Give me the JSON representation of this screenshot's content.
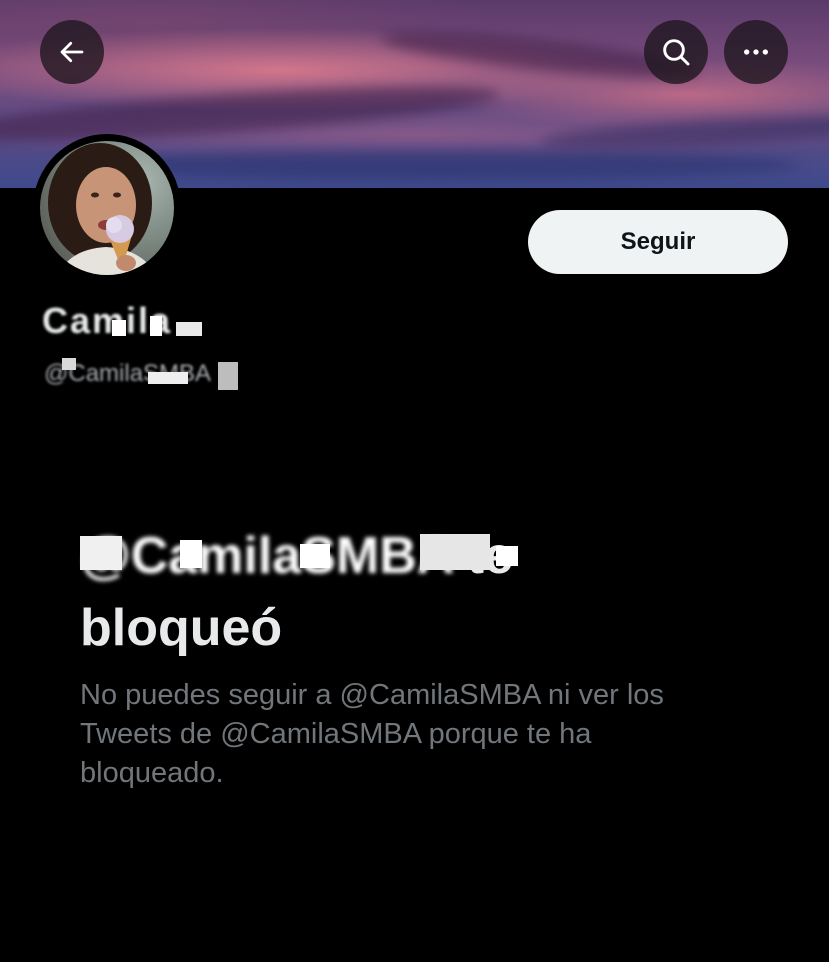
{
  "header": {
    "back_icon": "arrow-left-icon",
    "search_icon": "search-icon",
    "more_icon": "more-horizontal-icon"
  },
  "profile": {
    "display_name": "Camila",
    "handle": "@CamilaSMBA",
    "follow_label": "Seguir"
  },
  "blocked": {
    "title_handle": "@CamilaSMBA",
    "title_rest": " te bloqueó",
    "description": "No puedes seguir a @CamilaSMBA ni ver los Tweets de @CamilaSMBA porque te ha bloqueado."
  },
  "colors": {
    "background": "#000000",
    "follow_button_bg": "#eff3f4",
    "follow_button_text": "#0f1419",
    "primary_text": "#e7e9ea",
    "secondary_text": "#71767b"
  }
}
